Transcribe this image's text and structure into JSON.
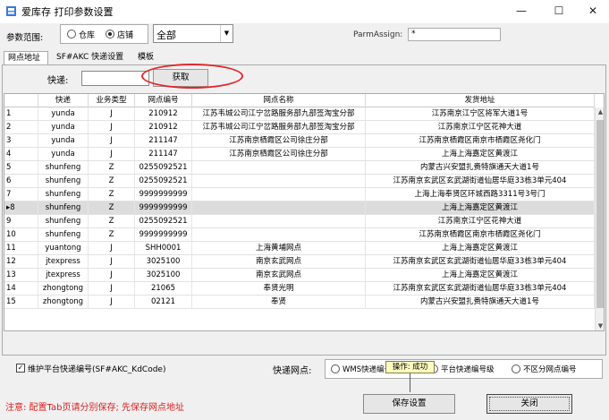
{
  "window": {
    "title": "爱库存 打印参数设置",
    "controls": {
      "minimize": "—",
      "maximize": "☐",
      "close": "✕"
    }
  },
  "params": {
    "scope_label": "参数范围:",
    "scope_options": [
      {
        "label": "仓库",
        "checked": false
      },
      {
        "label": "店铺",
        "checked": true
      }
    ],
    "scope_select_value": "全部",
    "parm_assign_label": "ParmAssign:",
    "parm_assign_value": "*"
  },
  "tabs": [
    {
      "label": "网点地址",
      "active": true
    },
    {
      "label": "SF#AKC 快递设置",
      "active": false
    },
    {
      "label": "模板",
      "active": false
    }
  ],
  "filter": {
    "express_label": "快递:",
    "express_value": "",
    "fetch_label": "获取"
  },
  "grid": {
    "columns": [
      "",
      "快递",
      "业务类型",
      "网点编号",
      "网点名称",
      "发货地址"
    ],
    "rows": [
      {
        "idx": "1",
        "express": "yunda",
        "type": "J",
        "code": "210912",
        "name": "江苏韦城公司江宁岔路服务部九部签淘宝分部",
        "address": "江苏南京江宁区将军大道1号"
      },
      {
        "idx": "2",
        "express": "yunda",
        "type": "J",
        "code": "210912",
        "name": "江苏韦城公司江宁岔路服务部九部签淘宝分部",
        "address": "江苏南京江宁区花神大道"
      },
      {
        "idx": "3",
        "express": "yunda",
        "type": "J",
        "code": "211147",
        "name": "江苏南京栖霞区公司徐庄分部",
        "address": "江苏南京栖霞区南京市栖霞区尧化门"
      },
      {
        "idx": "4",
        "express": "yunda",
        "type": "J",
        "code": "211147",
        "name": "江苏南京栖霞区公司徐庄分部",
        "address": "上海上海嘉定区黄渡江"
      },
      {
        "idx": "5",
        "express": "shunfeng",
        "type": "Z",
        "code": "0255092521",
        "name": "",
        "address": "内蒙古兴安盟扎赉特旗通天大道1号"
      },
      {
        "idx": "6",
        "express": "shunfeng",
        "type": "Z",
        "code": "0255092521",
        "name": "",
        "address": "江苏南京玄武区玄武湖街道仙居华庭33栋3单元404"
      },
      {
        "idx": "7",
        "express": "shunfeng",
        "type": "Z",
        "code": "9999999999",
        "name": "",
        "address": "上海上海奉贤区环城西路3311号3号门"
      },
      {
        "idx": "▸8",
        "express": "shunfeng",
        "type": "Z",
        "code": "9999999999",
        "name": "",
        "address": "上海上海嘉定区黄渡江",
        "selected": true
      },
      {
        "idx": "9",
        "express": "shunfeng",
        "type": "Z",
        "code": "0255092521",
        "name": "",
        "address": "江苏南京江宁区花神大道"
      },
      {
        "idx": "10",
        "express": "shunfeng",
        "type": "Z",
        "code": "9999999999",
        "name": "",
        "address": "江苏南京栖霞区南京市栖霞区尧化门"
      },
      {
        "idx": "11",
        "express": "yuantong",
        "type": "J",
        "code": "SHH0001",
        "name": "上海黄埔网点",
        "address": "上海上海嘉定区黄渡江"
      },
      {
        "idx": "12",
        "express": "jtexpress",
        "type": "J",
        "code": "3025100",
        "name": "南京玄武网点",
        "address": "江苏南京玄武区玄武湖街道仙居华庭33栋3单元404"
      },
      {
        "idx": "13",
        "express": "jtexpress",
        "type": "J",
        "code": "3025100",
        "name": "南京玄武网点",
        "address": "上海上海嘉定区黄渡江"
      },
      {
        "idx": "14",
        "express": "zhongtong",
        "type": "J",
        "code": "21065",
        "name": "奉贤光明",
        "address": "江苏南京玄武区玄武湖街道仙居华庭33栋3单元404"
      },
      {
        "idx": "15",
        "express": "zhongtong",
        "type": "J",
        "code": "02121",
        "name": "奉贤",
        "address": "内蒙古兴安盟扎赉特旗通天大道1号"
      }
    ]
  },
  "options": {
    "maintain_label": "维护平台快递编号(SF#AKC_KdCode)",
    "maintain_checked": true,
    "netpoint_label": "快递网点:",
    "netpoint_options": [
      {
        "label": "WMS快递编号",
        "checked": false
      },
      {
        "label": "平台快递编号级",
        "checked": false
      },
      {
        "label": "不区分网点编号",
        "checked": false
      }
    ]
  },
  "tooltip": {
    "text": "操作: 成功"
  },
  "footer": {
    "notice": "注意: 配置Tab页请分别保存; 先保存网点地址",
    "save_label": "保存设置",
    "close_label": "关闭"
  }
}
